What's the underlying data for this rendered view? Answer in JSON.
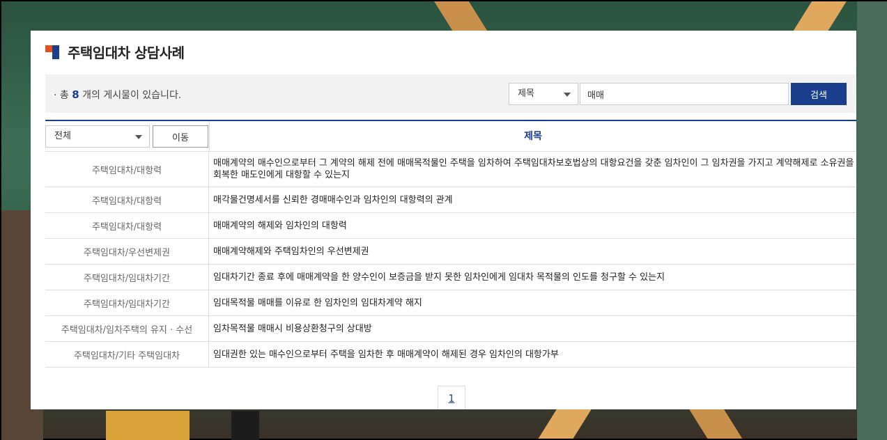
{
  "page": {
    "title": "주택임대차 상담사례"
  },
  "summary": {
    "prefix": "· 총 ",
    "count": "8",
    "suffix": " 개의 게시물이 있습니다."
  },
  "search": {
    "field_selected": "제목",
    "query": "매매",
    "button_label": "검색"
  },
  "table": {
    "category_selected": "전체",
    "move_button_label": "이동",
    "header_title": "제목",
    "rows": [
      {
        "category": "주택임대차/대항력",
        "subject": "매매계약의 매수인으로부터 그 계약의 해제 전에 매매목적물인 주택을 임차하여 주택임대차보호법상의 대항요건을 갖춘 임차인이 그 임차권을 가지고 계약해제로 소유권을 회복한 매도인에게 대항할 수 있는지"
      },
      {
        "category": "주택임대차/대항력",
        "subject": "매각물건명세서를 신뢰한 경매매수인과 임차인의 대항력의 관계"
      },
      {
        "category": "주택임대차/대항력",
        "subject": "매매계약의 해제와 임차인의 대항력"
      },
      {
        "category": "주택임대차/우선변제권",
        "subject": "매매계약해제와 주택임차인의 우선변제권"
      },
      {
        "category": "주택임대차/임대차기간",
        "subject": "임대차기간 종료 후에 매매계약을 한 양수인이 보증금을 받지 못한 임차인에게 임대차 목적물의 인도를 청구할 수 있는지"
      },
      {
        "category": "주택임대차/임대차기간",
        "subject": "임대목적물 매매를 이유로 한 임차인의 임대차계약 해지"
      },
      {
        "category": "주택임대차/임차주택의 유지 · 수선",
        "subject": "임차목적물 매매시 비용상환청구의 상대방"
      },
      {
        "category": "주택임대차/기타 주택임대차",
        "subject": "임대권한 있는 매수인으로부터 주택을 임차한 후 매매계약이 해제된 경우 임차인의 대항가부"
      }
    ]
  },
  "pagination": {
    "current": "1"
  },
  "colors": {
    "accent_navy": "#1a3e8c",
    "accent_orange": "#e5531a"
  }
}
